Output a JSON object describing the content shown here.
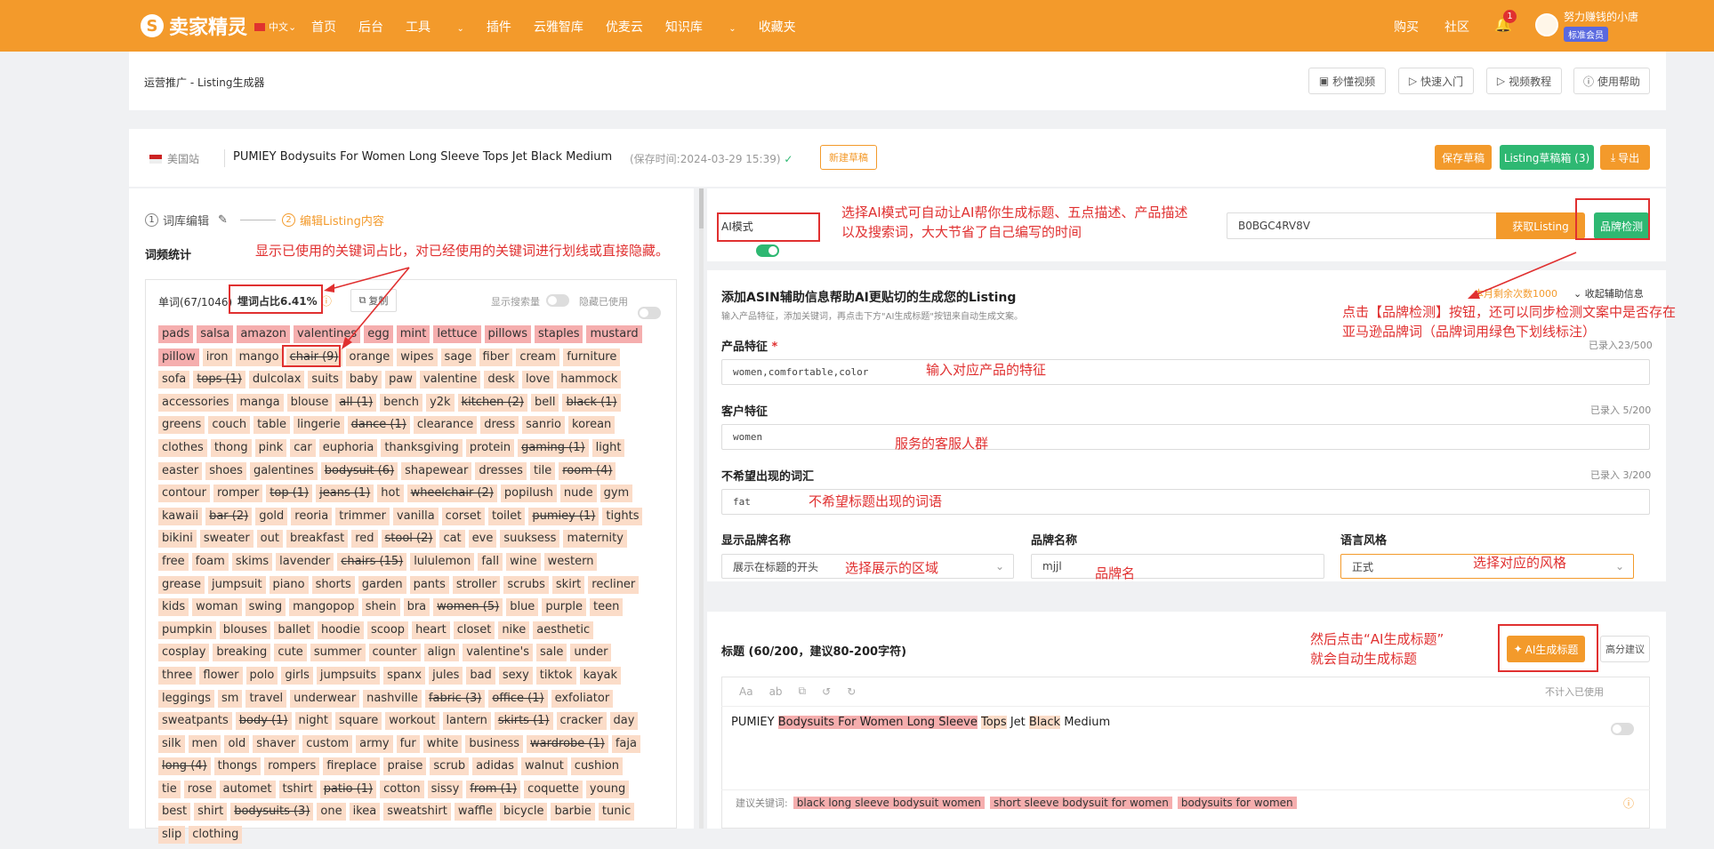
{
  "app": {
    "logo": "卖家精灵",
    "lang": "中文"
  },
  "nav": [
    "首页",
    "后台",
    "工具",
    "插件",
    "云雅智库",
    "优麦云",
    "知识库",
    "收藏夹"
  ],
  "topright": {
    "buy": "购买",
    "community": "社区",
    "notif_count": "1",
    "username": "努力赚钱的小唐",
    "member": "标准会员"
  },
  "breadcrumb": "运营推广 - Listing生成器",
  "help_buttons": [
    "秒懂视频",
    "快速入门",
    "视频教程",
    "使用帮助"
  ],
  "listing": {
    "site": "美国站",
    "title": "PUMIEY Bodysuits For Women Long Sleeve Tops Jet Black Medium",
    "saved": "(保存时间:2024-03-29 15:39)",
    "new_draft": "新建草稿",
    "save_draft": "保存草稿",
    "draft_box": "Listing草稿箱 (3)",
    "export": "导出"
  },
  "steps": {
    "step1": "词库编辑",
    "step2": "编辑Listing内容"
  },
  "freq": {
    "title": "词频统计",
    "words": "单词(67/1046)",
    "ratio": "埋词占比6.41%",
    "copy": "复制",
    "show_volume": "显示搜索量",
    "hide_used": "隐藏已使用"
  },
  "chips": [
    [
      "pads",
      "h"
    ],
    [
      "salsa",
      "h"
    ],
    [
      "amazon",
      "h"
    ],
    [
      "valentines",
      "h"
    ],
    [
      "egg",
      "h"
    ],
    [
      "mint",
      "h"
    ],
    [
      "lettuce",
      "h"
    ],
    [
      "pillows",
      "h"
    ],
    [
      "staples",
      "h"
    ],
    [
      "mustard",
      "h"
    ],
    [
      "pillow",
      "h"
    ],
    [
      "iron",
      ""
    ],
    [
      "mango",
      ""
    ],
    [
      "chair (9)",
      "s"
    ],
    [
      "orange",
      ""
    ],
    [
      "wipes",
      ""
    ],
    [
      "sage",
      ""
    ],
    [
      "fiber",
      ""
    ],
    [
      "cream",
      ""
    ],
    [
      "furniture",
      ""
    ],
    [
      "sofa",
      ""
    ],
    [
      "tops (1)",
      "s"
    ],
    [
      "dulcolax",
      ""
    ],
    [
      "suits",
      ""
    ],
    [
      "baby",
      ""
    ],
    [
      "paw",
      ""
    ],
    [
      "valentine",
      ""
    ],
    [
      "desk",
      ""
    ],
    [
      "love",
      ""
    ],
    [
      "hammock",
      ""
    ],
    [
      "accessories",
      ""
    ],
    [
      "manga",
      ""
    ],
    [
      "blouse",
      ""
    ],
    [
      "all (1)",
      "s"
    ],
    [
      "bench",
      ""
    ],
    [
      "y2k",
      ""
    ],
    [
      "kitchen (2)",
      "s"
    ],
    [
      "bell",
      ""
    ],
    [
      "black (1)",
      "s"
    ],
    [
      "greens",
      ""
    ],
    [
      "couch",
      ""
    ],
    [
      "table",
      ""
    ],
    [
      "lingerie",
      ""
    ],
    [
      "dance (1)",
      "s"
    ],
    [
      "clearance",
      ""
    ],
    [
      "dress",
      ""
    ],
    [
      "sanrio",
      ""
    ],
    [
      "korean",
      ""
    ],
    [
      "clothes",
      ""
    ],
    [
      "thong",
      ""
    ],
    [
      "pink",
      ""
    ],
    [
      "car",
      ""
    ],
    [
      "euphoria",
      ""
    ],
    [
      "thanksgiving",
      ""
    ],
    [
      "protein",
      ""
    ],
    [
      "gaming (1)",
      "s"
    ],
    [
      "light",
      ""
    ],
    [
      "easter",
      ""
    ],
    [
      "shoes",
      ""
    ],
    [
      "galentines",
      ""
    ],
    [
      "bodysuit (6)",
      "s"
    ],
    [
      "shapewear",
      ""
    ],
    [
      "dresses",
      ""
    ],
    [
      "tile",
      ""
    ],
    [
      "room (4)",
      "s"
    ],
    [
      "contour",
      ""
    ],
    [
      "romper",
      ""
    ],
    [
      "top (1)",
      "s"
    ],
    [
      "jeans (1)",
      "s"
    ],
    [
      "hot",
      ""
    ],
    [
      "wheelchair (2)",
      "s"
    ],
    [
      "popilush",
      ""
    ],
    [
      "nude",
      ""
    ],
    [
      "gym",
      ""
    ],
    [
      "kawaii",
      ""
    ],
    [
      "bar (2)",
      "s"
    ],
    [
      "gold",
      ""
    ],
    [
      "reoria",
      ""
    ],
    [
      "trimmer",
      ""
    ],
    [
      "vanilla",
      ""
    ],
    [
      "corset",
      ""
    ],
    [
      "toilet",
      ""
    ],
    [
      "pumiey (1)",
      "s"
    ],
    [
      "tights",
      ""
    ],
    [
      "bikini",
      ""
    ],
    [
      "sweater",
      ""
    ],
    [
      "out",
      ""
    ],
    [
      "breakfast",
      ""
    ],
    [
      "red",
      ""
    ],
    [
      "stool (2)",
      "s"
    ],
    [
      "cat",
      ""
    ],
    [
      "eve",
      ""
    ],
    [
      "suuksess",
      ""
    ],
    [
      "maternity",
      ""
    ],
    [
      "free",
      ""
    ],
    [
      "foam",
      ""
    ],
    [
      "skims",
      ""
    ],
    [
      "lavender",
      ""
    ],
    [
      "chairs (15)",
      "s"
    ],
    [
      "lululemon",
      ""
    ],
    [
      "fall",
      ""
    ],
    [
      "wine",
      ""
    ],
    [
      "western",
      ""
    ],
    [
      "grease",
      ""
    ],
    [
      "jumpsuit",
      ""
    ],
    [
      "piano",
      ""
    ],
    [
      "shorts",
      ""
    ],
    [
      "garden",
      ""
    ],
    [
      "pants",
      ""
    ],
    [
      "stroller",
      ""
    ],
    [
      "scrubs",
      ""
    ],
    [
      "skirt",
      ""
    ],
    [
      "recliner",
      ""
    ],
    [
      "kids",
      ""
    ],
    [
      "woman",
      ""
    ],
    [
      "swing",
      ""
    ],
    [
      "mangopop",
      ""
    ],
    [
      "shein",
      ""
    ],
    [
      "bra",
      ""
    ],
    [
      "women (5)",
      "s"
    ],
    [
      "blue",
      ""
    ],
    [
      "purple",
      ""
    ],
    [
      "teen",
      ""
    ],
    [
      "pumpkin",
      ""
    ],
    [
      "blouses",
      ""
    ],
    [
      "ballet",
      ""
    ],
    [
      "hoodie",
      ""
    ],
    [
      "scoop",
      ""
    ],
    [
      "heart",
      ""
    ],
    [
      "closet",
      ""
    ],
    [
      "nike",
      ""
    ],
    [
      "aesthetic",
      ""
    ],
    [
      "cosplay",
      ""
    ],
    [
      "breaking",
      ""
    ],
    [
      "cute",
      ""
    ],
    [
      "summer",
      ""
    ],
    [
      "counter",
      ""
    ],
    [
      "align",
      ""
    ],
    [
      "valentine's",
      ""
    ],
    [
      "sale",
      ""
    ],
    [
      "under",
      ""
    ],
    [
      "three",
      ""
    ],
    [
      "flower",
      ""
    ],
    [
      "polo",
      ""
    ],
    [
      "girls",
      ""
    ],
    [
      "jumpsuits",
      ""
    ],
    [
      "spanx",
      ""
    ],
    [
      "jules",
      ""
    ],
    [
      "bad",
      ""
    ],
    [
      "sexy",
      ""
    ],
    [
      "tiktok",
      ""
    ],
    [
      "kayak",
      ""
    ],
    [
      "leggings",
      ""
    ],
    [
      "sm",
      ""
    ],
    [
      "travel",
      ""
    ],
    [
      "underwear",
      ""
    ],
    [
      "nashville",
      ""
    ],
    [
      "fabric (3)",
      "s"
    ],
    [
      "office (1)",
      "s"
    ],
    [
      "exfoliator",
      ""
    ],
    [
      "sweatpants",
      ""
    ],
    [
      "body (1)",
      "s"
    ],
    [
      "night",
      ""
    ],
    [
      "square",
      ""
    ],
    [
      "workout",
      ""
    ],
    [
      "lantern",
      ""
    ],
    [
      "skirts (1)",
      "s"
    ],
    [
      "cracker",
      ""
    ],
    [
      "day",
      ""
    ],
    [
      "silk",
      ""
    ],
    [
      "men",
      ""
    ],
    [
      "old",
      ""
    ],
    [
      "shaver",
      ""
    ],
    [
      "custom",
      ""
    ],
    [
      "army",
      ""
    ],
    [
      "fur",
      ""
    ],
    [
      "white",
      ""
    ],
    [
      "business",
      ""
    ],
    [
      "wardrobe (1)",
      "s"
    ],
    [
      "faja",
      ""
    ],
    [
      "long (4)",
      "s"
    ],
    [
      "thongs",
      ""
    ],
    [
      "rompers",
      ""
    ],
    [
      "fireplace",
      ""
    ],
    [
      "praise",
      ""
    ],
    [
      "scrub",
      ""
    ],
    [
      "adidas",
      ""
    ],
    [
      "walnut",
      ""
    ],
    [
      "cushion",
      ""
    ],
    [
      "tie",
      ""
    ],
    [
      "rose",
      ""
    ],
    [
      "automet",
      ""
    ],
    [
      "tshirt",
      ""
    ],
    [
      "patio (1)",
      "s"
    ],
    [
      "cotton",
      ""
    ],
    [
      "sissy",
      ""
    ],
    [
      "from (1)",
      "s"
    ],
    [
      "coquette",
      ""
    ],
    [
      "young",
      ""
    ],
    [
      "best",
      ""
    ],
    [
      "shirt",
      ""
    ],
    [
      "bodysuits (3)",
      "s"
    ],
    [
      "one",
      ""
    ],
    [
      "ikea",
      ""
    ],
    [
      "sweatshirt",
      ""
    ],
    [
      "waffle",
      ""
    ],
    [
      "bicycle",
      ""
    ],
    [
      "barbie",
      ""
    ],
    [
      "tunic",
      ""
    ],
    [
      "slip",
      ""
    ],
    [
      "clothing",
      ""
    ]
  ],
  "ai": {
    "mode": "AI模式",
    "asin": "B0BGC4RV8V",
    "fetch": "获取Listing",
    "brand_check": "品牌检测"
  },
  "aux": {
    "title": "添加ASIN辅助信息帮助AI更贴切的生成您的Listing",
    "desc": "输入产品特征，添加关键词，再点击下方\"AI生成标题\"按钮来自动生成文案。",
    "remaining": "本月剩余次数1000",
    "collapse": "收起辅助信息",
    "f1_label": "产品特征",
    "f1_required": "*",
    "f1_value": "women,comfortable,color",
    "f1_count": "已录入23/500",
    "f2_label": "客户特征",
    "f2_value": "women",
    "f2_count": "已录入 5/200",
    "f3_label": "不希望出现的词汇",
    "f3_value": "fat",
    "f3_count": "已录入 3/200",
    "f4_label": "显示品牌名称",
    "f4_value": "展示在标题的开头",
    "f5_label": "品牌名称",
    "f5_value": "mjjl",
    "f6_label": "语言风格",
    "f6_value": "正式"
  },
  "titlebox": {
    "label": "标题 (60/200，建议80-200字符)",
    "ai_btn": "AI生成标题",
    "score_btn": "高分建议",
    "t_aa": "Aa",
    "t_ab": "ab",
    "exclude": "不计入已使用",
    "text_parts": [
      [
        "PUMIEY ",
        ""
      ],
      [
        "Bodysuits For Women Long Sleeve",
        "hl"
      ],
      [
        " ",
        ""
      ],
      [
        "Tops",
        "hl2"
      ],
      [
        " Jet ",
        ""
      ],
      [
        "Black",
        "hl2"
      ],
      [
        " Medium",
        ""
      ]
    ],
    "sugg_label": "建议关键词:",
    "sugg": [
      "black long sleeve bodysuit women",
      "short sleeve bodysuit for women",
      "bodysuits for women"
    ]
  },
  "annotations": {
    "a1": "显示已使用的关键词占比，对已经使用的关键词进行划线或直接隐藏。",
    "a2a": "选择AI模式可自动让AI帮你生成标题、五点描述、产品描述",
    "a2b": "以及搜索词，大大节省了自己编写的时间",
    "a3a": "点击【品牌检测】按钮，还可以同步检测文案中是否存在",
    "a3b": "亚马逊品牌词（品牌词用绿色下划线标注）",
    "a4": "输入对应产品的特征",
    "a5": "服务的客服人群",
    "a6": "不希望标题出现的词语",
    "a7": "选择展示的区域",
    "a8": "品牌名",
    "a9": "选择对应的风格",
    "a10a": "然后点击“AI生成标题”",
    "a10b": "就会自动生成标题"
  },
  "colors": {
    "brand": "#f39a2b",
    "green": "#2eb872",
    "annotation": "#e03030"
  }
}
